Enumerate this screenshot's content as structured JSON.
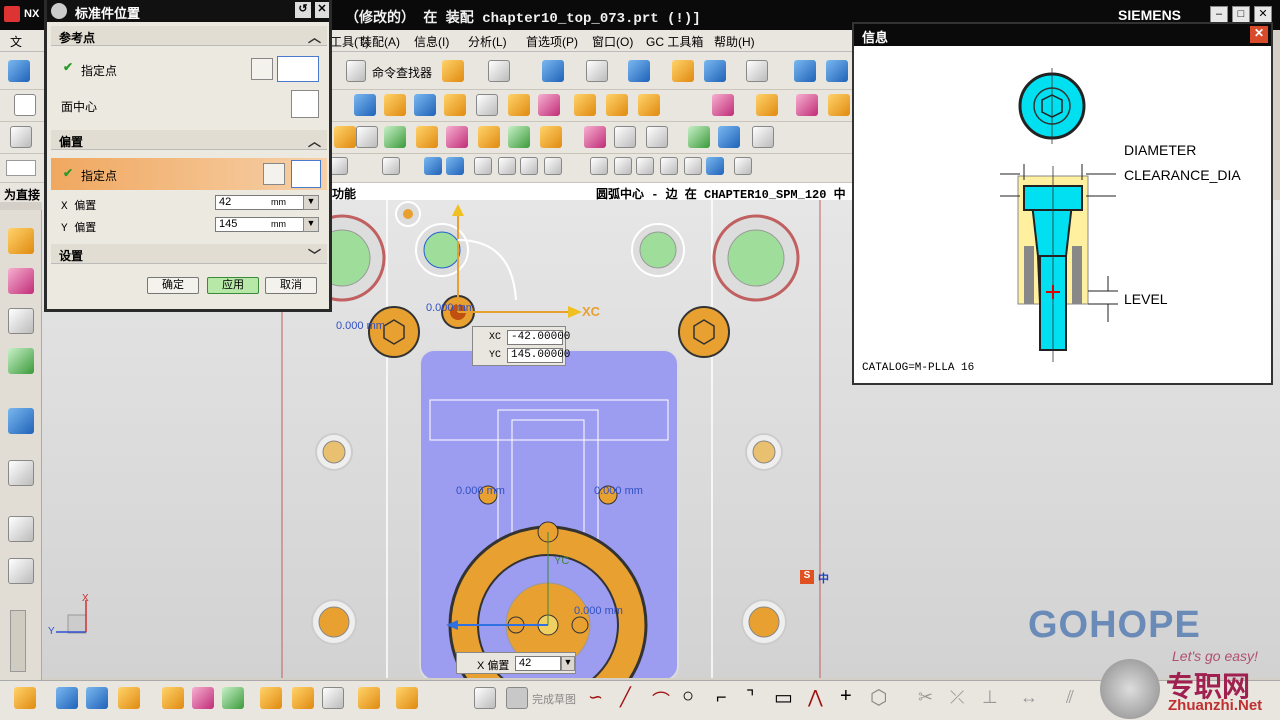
{
  "titlebar": {
    "app": "NX",
    "title": "（修改的）   在 装配 chapter10_top_073.prt    (!)]",
    "brand": "SIEMENS"
  },
  "menu": {
    "items": [
      "工具(T)",
      "装配(A)",
      "信息(I)",
      "分析(L)",
      "首选项(P)",
      "窗口(O)",
      "GC 工具箱",
      "帮助(H)"
    ],
    "partial_left": "文"
  },
  "toolbar": {
    "command_finder": "命令查找器"
  },
  "left_label": "为直接",
  "statusline": {
    "left": "功能",
    "right": "圆弧中心 - 边 在 CHAPTER10_SPM_120 中"
  },
  "dialog": {
    "title": "标准件位置",
    "section_ref": "参考点",
    "specify_point": "指定点",
    "face_center": "面中心",
    "section_offset": "偏置",
    "specify_point_2": "指定点",
    "x_label": "X 偏置",
    "x_value": "42",
    "y_label": "Y 偏置",
    "y_value": "145",
    "unit": "mm",
    "section_settings": "设置",
    "ok": "确定",
    "apply": "应用",
    "cancel": "取消"
  },
  "info": {
    "title": "信息",
    "diameter": "DIAMETER",
    "clearance": "CLEARANCE_DIA",
    "level": "LEVEL",
    "catalog": "CATALOG=M-PLLA 16"
  },
  "viewport": {
    "xc_label": "XC",
    "yc_label": "YC",
    "xc_value": "-42.00000",
    "yc_value": "145.00000",
    "dim_text_1": "0.000 mm",
    "dim_text_2": "0.000 mm",
    "dim_text_3": "0.000 mm",
    "dim_text_4": "0.000 mm",
    "dim_text_5": "0.000 mm",
    "x_offset_label": "X 偏置",
    "x_offset_value": "42",
    "triad_x": "X",
    "triad_y": "Y",
    "ime": "中"
  },
  "watermark": {
    "logo": "GOHOPE",
    "site": "专职网",
    "url": "Zhuanzhi.Net",
    "tagline": "Let's go easy!"
  },
  "bottombar": {
    "finish_sketch": "完成草图"
  }
}
